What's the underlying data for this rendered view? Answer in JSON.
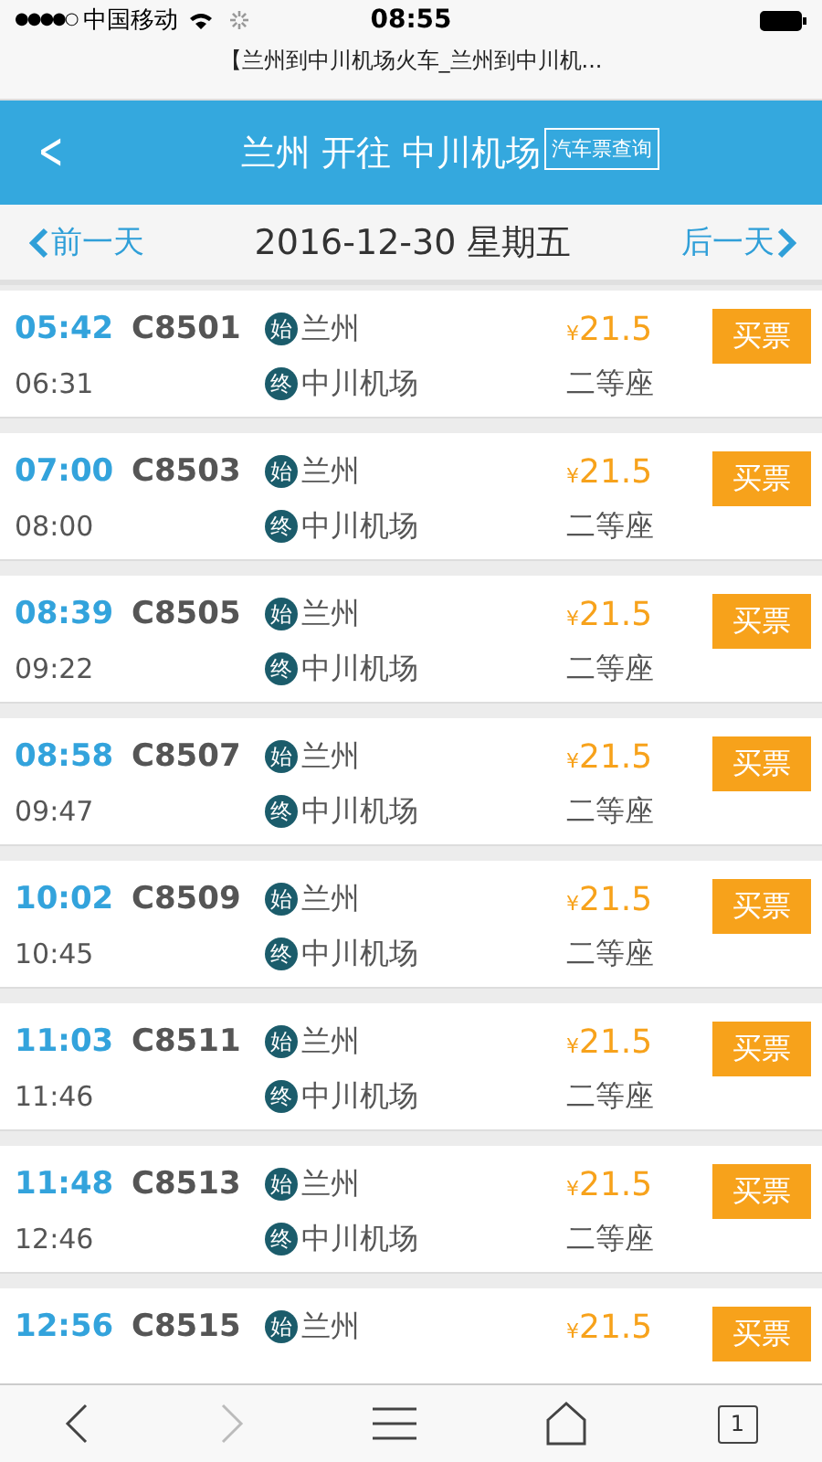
{
  "status_bar": {
    "signal": "●●●●○",
    "carrier": "中国移动",
    "time": "08:55"
  },
  "browser": {
    "page_title": "【兰州到中川机场火车_兰州到中川机..."
  },
  "header": {
    "back": "<",
    "title": "兰州 开往 中川机场",
    "bus_link": "汽车票查询"
  },
  "date_bar": {
    "prev": "前一天",
    "date": "2016-12-30 星期五",
    "next": "后一天"
  },
  "trains": [
    {
      "depart": "05:42",
      "arrive": "06:31",
      "number": "C8501",
      "from_tag": "始",
      "from": "兰州",
      "to_tag": "终",
      "to": "中川机场",
      "currency": "¥",
      "price": "21.5",
      "seat": "二等座",
      "buy": "买票"
    },
    {
      "depart": "07:00",
      "arrive": "08:00",
      "number": "C8503",
      "from_tag": "始",
      "from": "兰州",
      "to_tag": "终",
      "to": "中川机场",
      "currency": "¥",
      "price": "21.5",
      "seat": "二等座",
      "buy": "买票"
    },
    {
      "depart": "08:39",
      "arrive": "09:22",
      "number": "C8505",
      "from_tag": "始",
      "from": "兰州",
      "to_tag": "终",
      "to": "中川机场",
      "currency": "¥",
      "price": "21.5",
      "seat": "二等座",
      "buy": "买票"
    },
    {
      "depart": "08:58",
      "arrive": "09:47",
      "number": "C8507",
      "from_tag": "始",
      "from": "兰州",
      "to_tag": "终",
      "to": "中川机场",
      "currency": "¥",
      "price": "21.5",
      "seat": "二等座",
      "buy": "买票"
    },
    {
      "depart": "10:02",
      "arrive": "10:45",
      "number": "C8509",
      "from_tag": "始",
      "from": "兰州",
      "to_tag": "终",
      "to": "中川机场",
      "currency": "¥",
      "price": "21.5",
      "seat": "二等座",
      "buy": "买票"
    },
    {
      "depart": "11:03",
      "arrive": "11:46",
      "number": "C8511",
      "from_tag": "始",
      "from": "兰州",
      "to_tag": "终",
      "to": "中川机场",
      "currency": "¥",
      "price": "21.5",
      "seat": "二等座",
      "buy": "买票"
    },
    {
      "depart": "11:48",
      "arrive": "12:46",
      "number": "C8513",
      "from_tag": "始",
      "from": "兰州",
      "to_tag": "终",
      "to": "中川机场",
      "currency": "¥",
      "price": "21.5",
      "seat": "二等座",
      "buy": "买票"
    },
    {
      "depart": "12:56",
      "number": "C8515",
      "from_tag": "始",
      "from": "兰州",
      "currency": "¥",
      "price": "21.5",
      "buy": "买票"
    }
  ],
  "toolbar": {
    "tabs": "1"
  }
}
